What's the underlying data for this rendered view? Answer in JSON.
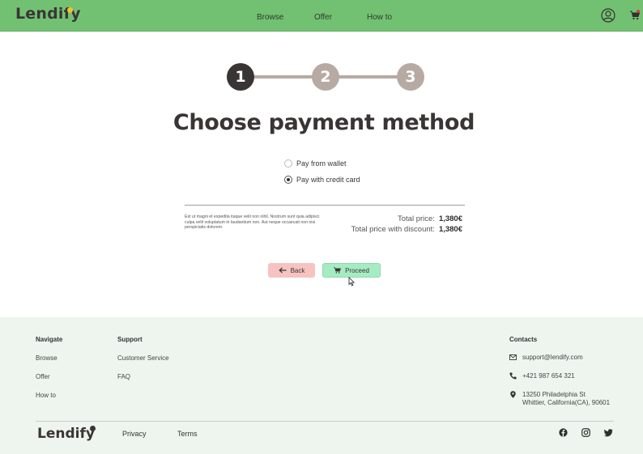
{
  "header": {
    "logo": "Lendify",
    "nav": [
      "Browse",
      "Offer",
      "How to"
    ],
    "colors": {
      "bg": "#72c172",
      "logo_dot": "#f2c230"
    }
  },
  "stepper": {
    "steps": [
      "1",
      "2",
      "3"
    ],
    "active": 1
  },
  "page_title": "Choose payment method",
  "payment": {
    "options": [
      "Pay from wallet",
      "Pay with credit card"
    ],
    "selected": "Pay with credit card"
  },
  "summary": {
    "lorem": "Est ut magni et expedita itaque velit non nihil. Nostrum sunt quia adipisci culpa velit voluptatum in laudantium non. Aut neque occaecati non nisi perspiciatis dolorem.",
    "total_label": "Total price:",
    "total_value": "1,380€",
    "discount_label": "Total price with discount:",
    "discount_value": "1,380€"
  },
  "buttons": {
    "back": "Back",
    "proceed": "Proceed"
  },
  "footer": {
    "navigate_title": "Navigate",
    "navigate": [
      "Browse",
      "Offer",
      "How to"
    ],
    "support_title": "Support",
    "support": [
      "Customer Service",
      "FAQ"
    ],
    "contacts_title": "Contacts",
    "email": "support@lendify.com",
    "phone": "+421 987 654 321",
    "address_line1": "13250 Philadelphia St",
    "address_line2": "Whittier, California(CA), 90601",
    "logo": "Lendify",
    "bottom_links": [
      "Privacy",
      "Terms"
    ],
    "social_icons": [
      "facebook-icon",
      "instagram-icon",
      "twitter-icon"
    ]
  }
}
